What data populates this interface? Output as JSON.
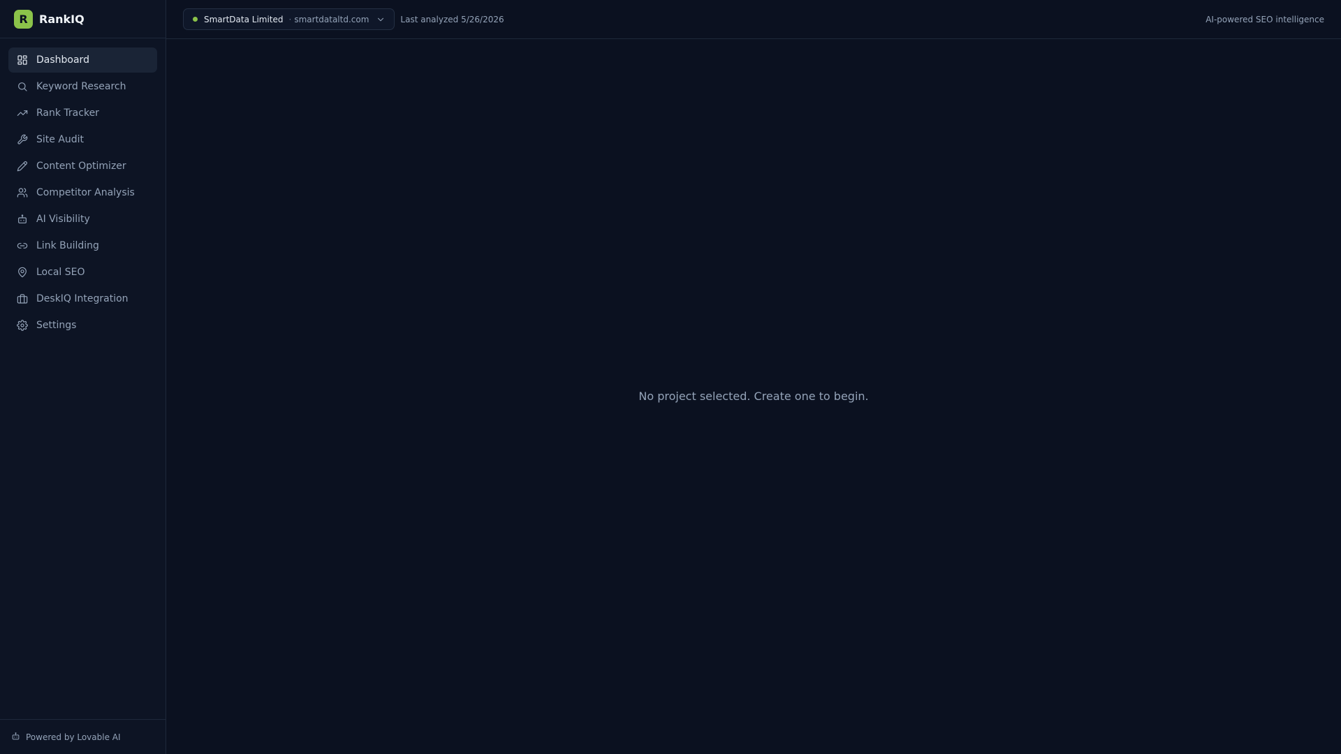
{
  "brand": {
    "logo_letter": "R",
    "name": "RankIQ"
  },
  "sidebar": {
    "items": [
      {
        "label": "Dashboard",
        "icon": "dashboard-grid-icon",
        "active": true
      },
      {
        "label": "Keyword Research",
        "icon": "search-icon",
        "active": false
      },
      {
        "label": "Rank Tracker",
        "icon": "trending-up-icon",
        "active": false
      },
      {
        "label": "Site Audit",
        "icon": "wrench-icon",
        "active": false
      },
      {
        "label": "Content Optimizer",
        "icon": "pen-icon",
        "active": false
      },
      {
        "label": "Competitor Analysis",
        "icon": "users-icon",
        "active": false
      },
      {
        "label": "AI Visibility",
        "icon": "bot-icon",
        "active": false
      },
      {
        "label": "Link Building",
        "icon": "link-icon",
        "active": false
      },
      {
        "label": "Local SEO",
        "icon": "map-pin-icon",
        "active": false
      },
      {
        "label": "DeskIQ Integration",
        "icon": "briefcase-icon",
        "active": false
      },
      {
        "label": "Settings",
        "icon": "gear-icon",
        "active": false
      }
    ],
    "footer": "Powered by Lovable AI"
  },
  "header": {
    "project_name": "SmartData Limited",
    "project_separator": "·",
    "project_domain": "smartdataltd.com",
    "last_analyzed": "Last analyzed 5/26/2026",
    "tagline": "AI-powered SEO intelligence"
  },
  "main": {
    "empty_message": "No project selected. Create one to begin."
  },
  "colors": {
    "accent": "#8bc34a",
    "background": "#0b1120",
    "sidebar": "#0d1424",
    "active_item": "#1a2436"
  }
}
